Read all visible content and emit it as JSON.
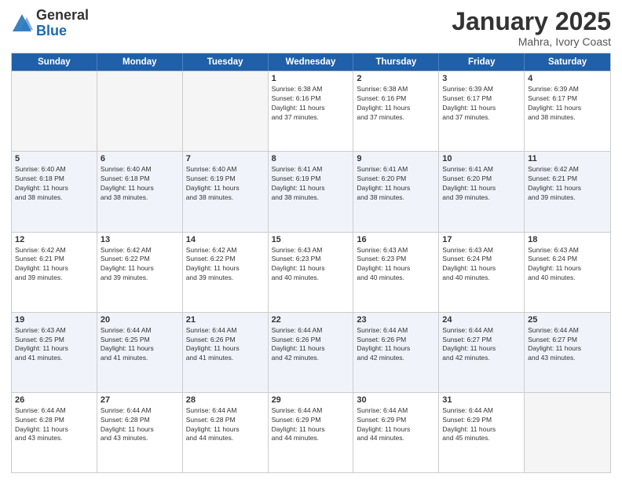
{
  "logo": {
    "general": "General",
    "blue": "Blue"
  },
  "title": {
    "month": "January 2025",
    "location": "Mahra, Ivory Coast"
  },
  "days": [
    "Sunday",
    "Monday",
    "Tuesday",
    "Wednesday",
    "Thursday",
    "Friday",
    "Saturday"
  ],
  "weeks": [
    [
      {
        "day": "",
        "text": ""
      },
      {
        "day": "",
        "text": ""
      },
      {
        "day": "",
        "text": ""
      },
      {
        "day": "1",
        "text": "Sunrise: 6:38 AM\nSunset: 6:16 PM\nDaylight: 11 hours\nand 37 minutes."
      },
      {
        "day": "2",
        "text": "Sunrise: 6:38 AM\nSunset: 6:16 PM\nDaylight: 11 hours\nand 37 minutes."
      },
      {
        "day": "3",
        "text": "Sunrise: 6:39 AM\nSunset: 6:17 PM\nDaylight: 11 hours\nand 37 minutes."
      },
      {
        "day": "4",
        "text": "Sunrise: 6:39 AM\nSunset: 6:17 PM\nDaylight: 11 hours\nand 38 minutes."
      }
    ],
    [
      {
        "day": "5",
        "text": "Sunrise: 6:40 AM\nSunset: 6:18 PM\nDaylight: 11 hours\nand 38 minutes."
      },
      {
        "day": "6",
        "text": "Sunrise: 6:40 AM\nSunset: 6:18 PM\nDaylight: 11 hours\nand 38 minutes."
      },
      {
        "day": "7",
        "text": "Sunrise: 6:40 AM\nSunset: 6:19 PM\nDaylight: 11 hours\nand 38 minutes."
      },
      {
        "day": "8",
        "text": "Sunrise: 6:41 AM\nSunset: 6:19 PM\nDaylight: 11 hours\nand 38 minutes."
      },
      {
        "day": "9",
        "text": "Sunrise: 6:41 AM\nSunset: 6:20 PM\nDaylight: 11 hours\nand 38 minutes."
      },
      {
        "day": "10",
        "text": "Sunrise: 6:41 AM\nSunset: 6:20 PM\nDaylight: 11 hours\nand 39 minutes."
      },
      {
        "day": "11",
        "text": "Sunrise: 6:42 AM\nSunset: 6:21 PM\nDaylight: 11 hours\nand 39 minutes."
      }
    ],
    [
      {
        "day": "12",
        "text": "Sunrise: 6:42 AM\nSunset: 6:21 PM\nDaylight: 11 hours\nand 39 minutes."
      },
      {
        "day": "13",
        "text": "Sunrise: 6:42 AM\nSunset: 6:22 PM\nDaylight: 11 hours\nand 39 minutes."
      },
      {
        "day": "14",
        "text": "Sunrise: 6:42 AM\nSunset: 6:22 PM\nDaylight: 11 hours\nand 39 minutes."
      },
      {
        "day": "15",
        "text": "Sunrise: 6:43 AM\nSunset: 6:23 PM\nDaylight: 11 hours\nand 40 minutes."
      },
      {
        "day": "16",
        "text": "Sunrise: 6:43 AM\nSunset: 6:23 PM\nDaylight: 11 hours\nand 40 minutes."
      },
      {
        "day": "17",
        "text": "Sunrise: 6:43 AM\nSunset: 6:24 PM\nDaylight: 11 hours\nand 40 minutes."
      },
      {
        "day": "18",
        "text": "Sunrise: 6:43 AM\nSunset: 6:24 PM\nDaylight: 11 hours\nand 40 minutes."
      }
    ],
    [
      {
        "day": "19",
        "text": "Sunrise: 6:43 AM\nSunset: 6:25 PM\nDaylight: 11 hours\nand 41 minutes."
      },
      {
        "day": "20",
        "text": "Sunrise: 6:44 AM\nSunset: 6:25 PM\nDaylight: 11 hours\nand 41 minutes."
      },
      {
        "day": "21",
        "text": "Sunrise: 6:44 AM\nSunset: 6:26 PM\nDaylight: 11 hours\nand 41 minutes."
      },
      {
        "day": "22",
        "text": "Sunrise: 6:44 AM\nSunset: 6:26 PM\nDaylight: 11 hours\nand 42 minutes."
      },
      {
        "day": "23",
        "text": "Sunrise: 6:44 AM\nSunset: 6:26 PM\nDaylight: 11 hours\nand 42 minutes."
      },
      {
        "day": "24",
        "text": "Sunrise: 6:44 AM\nSunset: 6:27 PM\nDaylight: 11 hours\nand 42 minutes."
      },
      {
        "day": "25",
        "text": "Sunrise: 6:44 AM\nSunset: 6:27 PM\nDaylight: 11 hours\nand 43 minutes."
      }
    ],
    [
      {
        "day": "26",
        "text": "Sunrise: 6:44 AM\nSunset: 6:28 PM\nDaylight: 11 hours\nand 43 minutes."
      },
      {
        "day": "27",
        "text": "Sunrise: 6:44 AM\nSunset: 6:28 PM\nDaylight: 11 hours\nand 43 minutes."
      },
      {
        "day": "28",
        "text": "Sunrise: 6:44 AM\nSunset: 6:28 PM\nDaylight: 11 hours\nand 44 minutes."
      },
      {
        "day": "29",
        "text": "Sunrise: 6:44 AM\nSunset: 6:29 PM\nDaylight: 11 hours\nand 44 minutes."
      },
      {
        "day": "30",
        "text": "Sunrise: 6:44 AM\nSunset: 6:29 PM\nDaylight: 11 hours\nand 44 minutes."
      },
      {
        "day": "31",
        "text": "Sunrise: 6:44 AM\nSunset: 6:29 PM\nDaylight: 11 hours\nand 45 minutes."
      },
      {
        "day": "",
        "text": ""
      }
    ]
  ]
}
